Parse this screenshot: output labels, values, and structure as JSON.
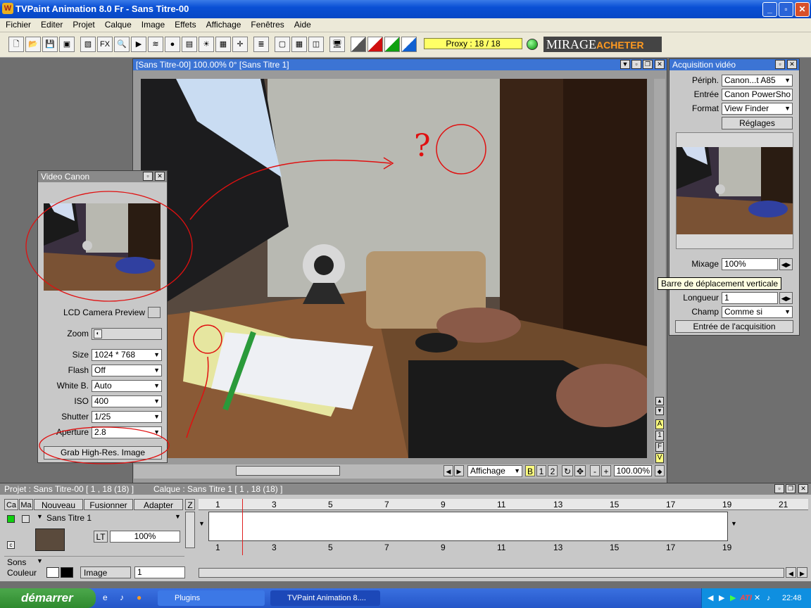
{
  "window": {
    "title": "TVPaint Animation 8.0 Fr - Sans Titre-00",
    "icon_letter": "W",
    "minimize": "_",
    "maximize": "▫",
    "close": "✕"
  },
  "menu": [
    "Fichier",
    "Editer",
    "Projet",
    "Calque",
    "Image",
    "Effets",
    "Affichage",
    "Fenêtres",
    "Aide"
  ],
  "toolbar": {
    "fx_label": "FX",
    "proxy": "Proxy : 18 / 18",
    "brand": "MIRAGE",
    "brand_action": "ACHETER"
  },
  "canvas_window": {
    "title": "[Sans Titre-00]  100.00%   0°  [Sans Titre 1]",
    "nav_label": "Affichage",
    "buffers": [
      "B",
      "1",
      "2"
    ],
    "zoom": "100.00%",
    "side_letters": [
      "A",
      "1",
      "F",
      "V"
    ]
  },
  "video_canon": {
    "title": "Video Canon",
    "lcd_label": "LCD Camera Preview",
    "zoom_label": "Zoom",
    "fields": [
      {
        "label": "Size",
        "value": "1024 * 768"
      },
      {
        "label": "Flash",
        "value": "Off"
      },
      {
        "label": "White B.",
        "value": "Auto"
      },
      {
        "label": "ISO",
        "value": "400"
      },
      {
        "label": "Shutter",
        "value": "1/25"
      },
      {
        "label": "Aperture",
        "value": "2.8"
      }
    ],
    "grab_button": "Grab High-Res. Image"
  },
  "acquisition": {
    "title": "Acquisition vidéo",
    "periph_label": "Périph.",
    "periph_value": "Canon...t A85",
    "entree_label": "Entrée",
    "entree_value": "Canon PowerSho",
    "format_label": "Format",
    "format_value": "View Finder",
    "reglages": "Réglages",
    "mixage_label": "Mixage",
    "mixage_value": "100%",
    "longueur_label": "Longueur",
    "longueur_value": "1",
    "champ_label": "Champ",
    "champ_value": "Comme si",
    "entry_button": "Entrée de l'acquisition"
  },
  "tooltip": "Barre de déplacement verticale",
  "timeline": {
    "project": "Projet : Sans Titre-00 [ 1 , 18  (18) ]",
    "calque": "Calque : Sans Titre 1 [ 1 , 18  (18) ]",
    "headers": [
      "Ca",
      "Ma",
      "Nouveau",
      "Fusionner",
      "Adapter",
      "Z"
    ],
    "layer_name": "Sans Titre 1",
    "lt": "LT",
    "opacity": "100%",
    "sons": "Sons",
    "couleur": "Couleur",
    "image": "Image",
    "image_value": "1",
    "c_label": "c",
    "frames": [
      "1",
      "3",
      "5",
      "7",
      "9",
      "11",
      "13",
      "15",
      "17",
      "19",
      "21"
    ],
    "frames_bottom": [
      "1",
      "3",
      "5",
      "7",
      "9",
      "11",
      "13",
      "15",
      "17",
      "19"
    ]
  },
  "taskbar": {
    "start": "démarrer",
    "tasks": [
      "Plugins",
      "TVPaint Animation 8...."
    ],
    "clock": "22:48",
    "ati": "ATI"
  }
}
